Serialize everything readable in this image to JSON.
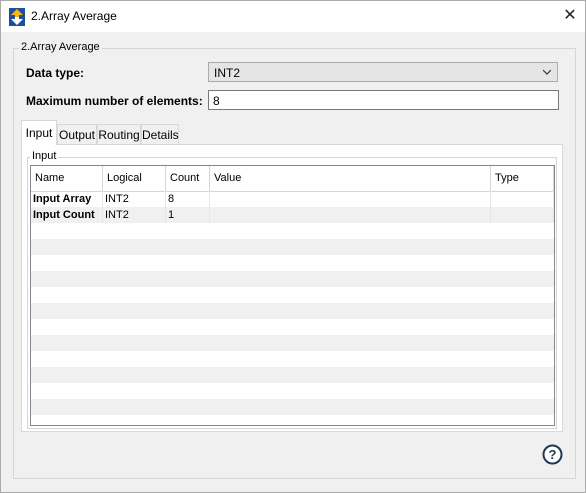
{
  "window": {
    "title": "2.Array Average",
    "close_glyph": "✕"
  },
  "group": {
    "legend": "2.Array Average"
  },
  "fields": {
    "data_type": {
      "label": "Data type:",
      "value": "INT2"
    },
    "max_elements": {
      "label": "Maximum number of elements:",
      "value": "8"
    }
  },
  "tabs": [
    {
      "label": "Input",
      "active": true
    },
    {
      "label": "Output"
    },
    {
      "label": "Routing"
    },
    {
      "label": "Details"
    }
  ],
  "input_panel": {
    "legend": "Input",
    "columns": [
      "Name",
      "Logical",
      "Count",
      "Value",
      "Type"
    ],
    "rows": [
      {
        "name": "Input Array",
        "logical": "INT2",
        "count": "8",
        "value": "",
        "type": ""
      },
      {
        "name": "Input Count",
        "logical": "INT2",
        "count": "1",
        "value": "",
        "type": ""
      }
    ]
  },
  "icons": {
    "app": "app-arrows-icon",
    "close": "close-icon",
    "help": "help-icon",
    "dropdown": "chevron-down-icon"
  },
  "colors": {
    "app_icon_yellow": "#f2b90f",
    "app_icon_blue": "#1e4f9c",
    "grid_alt_row": "#f0f0f0"
  }
}
